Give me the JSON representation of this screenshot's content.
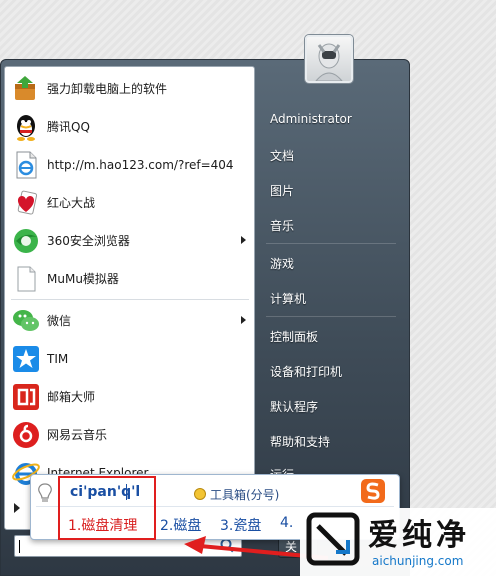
{
  "programs": [
    {
      "label": "强力卸载电脑上的软件",
      "icon": "uninstall-icon",
      "arrow": false
    },
    {
      "label": "腾讯QQ",
      "icon": "qq-penguin-icon",
      "arrow": false
    },
    {
      "label": "http://m.hao123.com/?ref=404",
      "icon": "web-page-icon",
      "arrow": false
    },
    {
      "label": "红心大战",
      "icon": "hearts-game-icon",
      "arrow": false
    },
    {
      "label": "360安全浏览器",
      "icon": "browser-360-icon",
      "arrow": true
    },
    {
      "label": "MuMu模拟器",
      "icon": "blank-file-icon",
      "arrow": false
    },
    {
      "label": "微信",
      "icon": "wechat-icon",
      "arrow": true
    },
    {
      "label": "TIM",
      "icon": "tim-icon",
      "arrow": false
    },
    {
      "label": "邮箱大师",
      "icon": "mail-master-icon",
      "arrow": false
    },
    {
      "label": "网易云音乐",
      "icon": "netease-music-icon",
      "arrow": false
    },
    {
      "label": "Internet Explorer",
      "icon": "ie-icon",
      "arrow": false
    }
  ],
  "right_items": [
    "Administrator",
    "文档",
    "图片",
    "音乐",
    "游戏",
    "计算机",
    "控制面板",
    "设备和打印机",
    "默认程序",
    "帮助和支持",
    "运行..."
  ],
  "shutdown_label": "关",
  "ime": {
    "pinyin": "ci'pan'q'l",
    "tools": "工具箱(分号)",
    "candidates": [
      "1.磁盘清理",
      "2.磁盘",
      "3.瓷盘",
      "4."
    ]
  },
  "watermark": {
    "title": "爱纯净",
    "url": "aichunjing.com"
  },
  "colors": {
    "highlight": "#e01e1e",
    "candidate_selected": "#d81e1e",
    "candidate": "#1a4fa3"
  }
}
